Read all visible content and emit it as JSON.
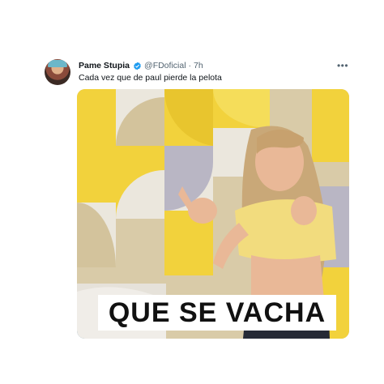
{
  "tweet": {
    "author_name": "Pame Stupia",
    "handle": "@FDoficial",
    "separator": "·",
    "time": "7h",
    "text": "Cada vez que de paul pierde la pelota",
    "more_icon": "more-horizontal-icon",
    "verified_icon": "verified-badge-icon",
    "verified_color": "#1d9bf0"
  },
  "media": {
    "caption": "QUE SE VACHA",
    "background_colors": [
      "#f2d23c",
      "#d9cba8",
      "#ebe7dd",
      "#b9b6c4"
    ]
  }
}
